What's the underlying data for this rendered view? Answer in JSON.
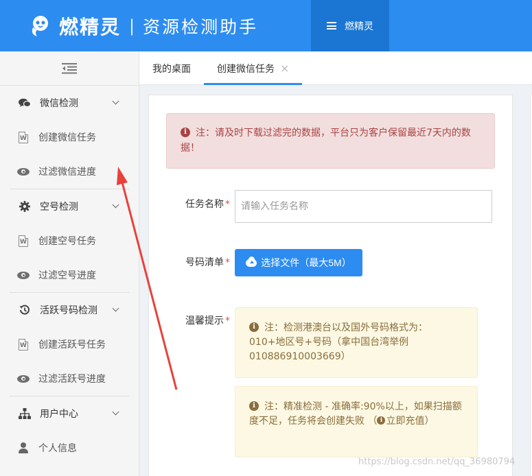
{
  "header": {
    "brand": "燃精灵",
    "separator": "|",
    "subtitle": "资源检测助手",
    "menu_label": "燃精灵"
  },
  "sidebar": {
    "groups": [
      {
        "label": "微信检测",
        "icon": "wechat-chat-icon",
        "items": [
          {
            "label": "创建微信任务",
            "icon": "document-icon"
          },
          {
            "label": "过滤微信进度",
            "icon": "eye-icon"
          }
        ]
      },
      {
        "label": "空号检测",
        "icon": "gear-icon",
        "items": [
          {
            "label": "创建空号任务",
            "icon": "document-icon"
          },
          {
            "label": "过滤空号进度",
            "icon": "eye-icon"
          }
        ]
      },
      {
        "label": "活跃号码检测",
        "icon": "history-icon",
        "items": [
          {
            "label": "创建活跃号任务",
            "icon": "document-icon"
          },
          {
            "label": "过滤活跃号进度",
            "icon": "eye-icon"
          }
        ]
      },
      {
        "label": "用户中心",
        "icon": "sitemap-icon",
        "items": [
          {
            "label": "个人信息",
            "icon": "user-icon"
          }
        ]
      }
    ]
  },
  "tabs": [
    {
      "label": "我的桌面",
      "active": false
    },
    {
      "label": "创建微信任务",
      "active": true,
      "close": "×"
    }
  ],
  "form": {
    "notice": "注：请及时下载过滤完的数据，平台只为客户保留最近7天内的数据！",
    "task_name_label": "任务名称",
    "task_name_placeholder": "请输入任务名称",
    "task_name_value": "",
    "number_list_label": "号码清单",
    "upload_button": "选择文件（最大5M）",
    "tips_label": "温馨提示",
    "required_mark": "*",
    "tip1": "注：检测港澳台以及国外号码格式为：010+地区号+号码（拿中国台湾举例010886910003669）",
    "tip2_before": "注：精准检测 - 准确率:90%以上，如果扫描额度不足，任务将会创建失败 （",
    "tip2_link": "立即充值",
    "tip2_after": "）"
  },
  "watermark": "https://blog.csdn.net/qq_36980794",
  "colors": {
    "header_bg": "#2d8cf0",
    "header_menu_bg": "#1a76d2",
    "danger_bg": "#f2dede",
    "danger_text": "#a94442",
    "warning_bg": "#fcf8e3",
    "warning_text": "#8a6d3b",
    "annotation_arrow": "#e8413b"
  }
}
